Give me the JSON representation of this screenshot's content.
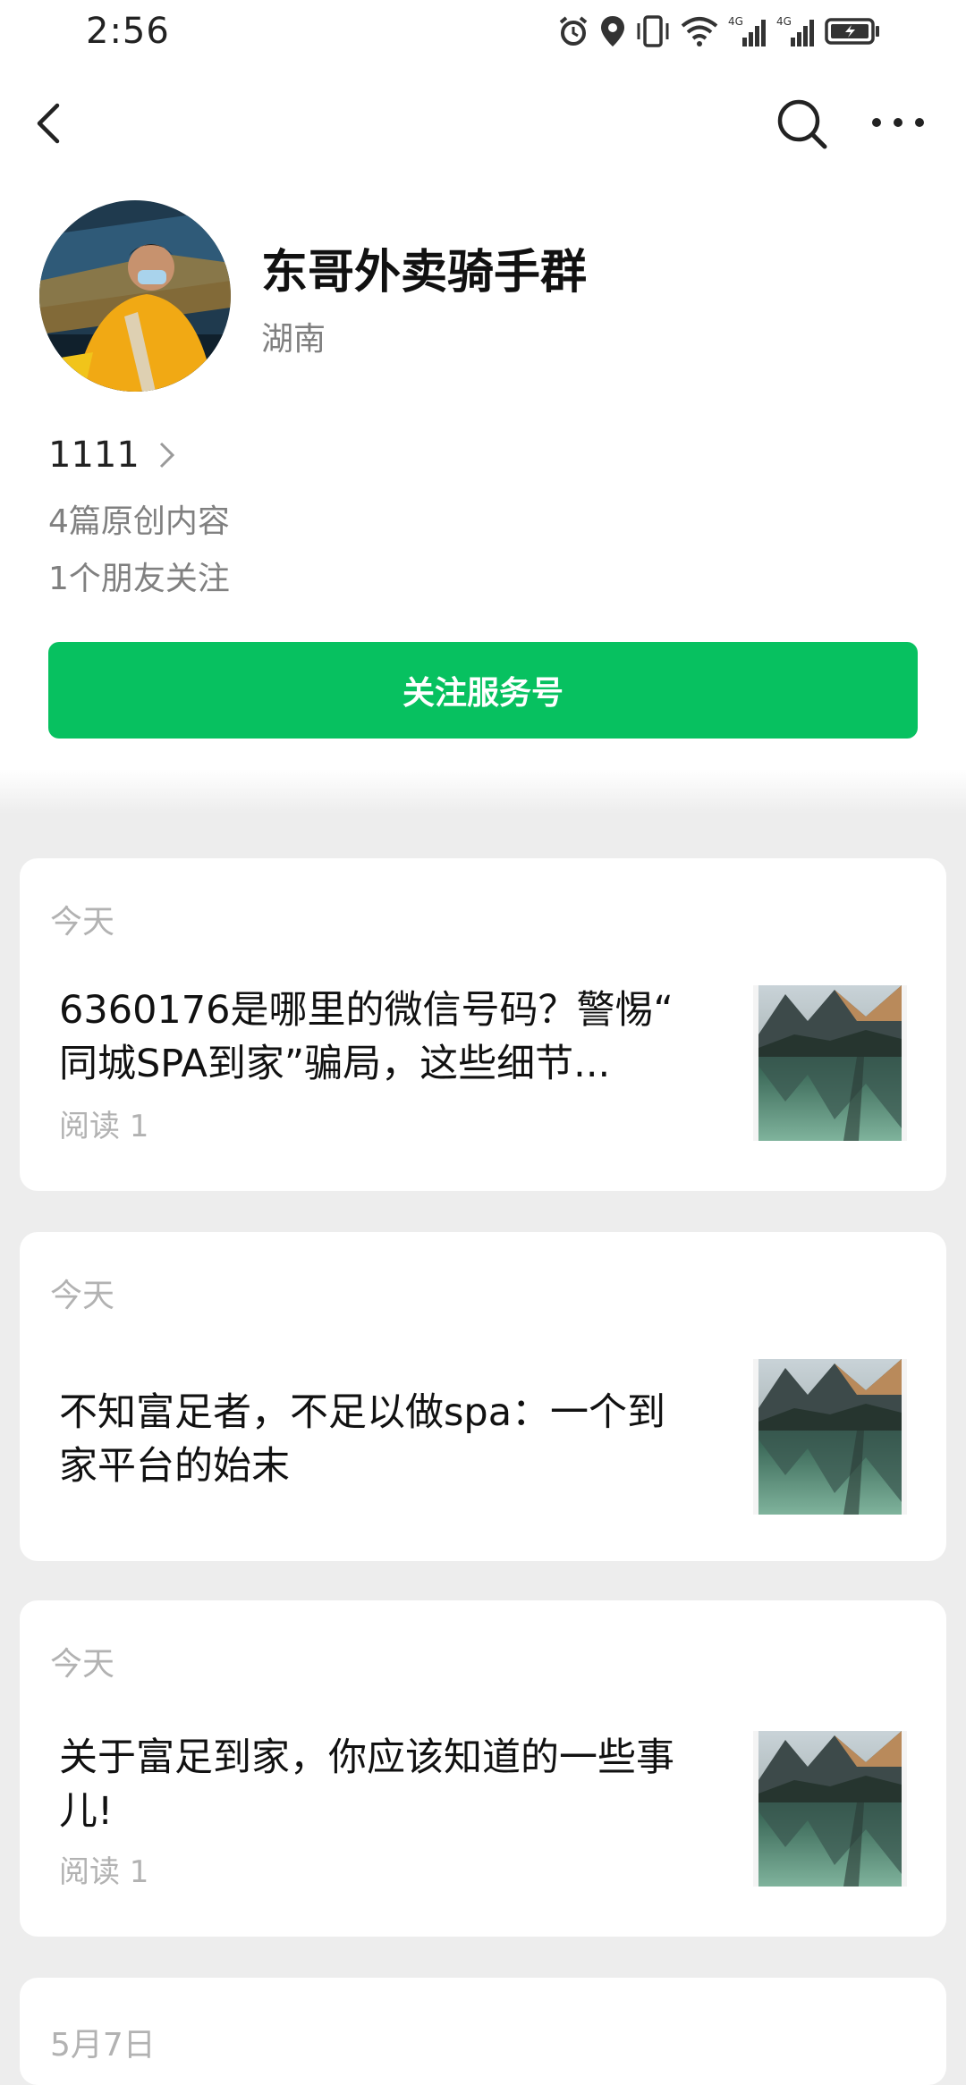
{
  "status_bar": {
    "time": "2:56",
    "icons": [
      "alarm-icon",
      "location-icon",
      "vibrate-icon",
      "wifi-icon",
      "signal-4g-icon",
      "signal-4g-icon",
      "battery-charging-icon"
    ],
    "network_label": "4G"
  },
  "nav": {
    "icons": [
      "back-icon",
      "search-icon",
      "more-icon"
    ]
  },
  "profile": {
    "name": "东哥外卖骑手群",
    "region": "湖南",
    "id_value": "1111",
    "original_count": "4篇原创内容",
    "friends_following": "1个朋友关注",
    "follow_button": "关注服务号"
  },
  "articles": [
    {
      "date": "今天",
      "title_line1": "6360176是哪里的微信号码？警惕“",
      "title_line2": "同城SPA到家”骗局，这些细节...",
      "reads": "阅读 1"
    },
    {
      "date": "今天",
      "title_line1": "不知富足者，不足以做spa：一个到",
      "title_line2": "家平台的始末",
      "reads": ""
    },
    {
      "date": "今天",
      "title_line1": "关于富足到家，你应该知道的一些事",
      "title_line2": "儿!",
      "reads": "阅读 1"
    },
    {
      "date": "5月7日"
    }
  ],
  "colors": {
    "accent_green": "#07c160",
    "page_background": "#ededed"
  }
}
